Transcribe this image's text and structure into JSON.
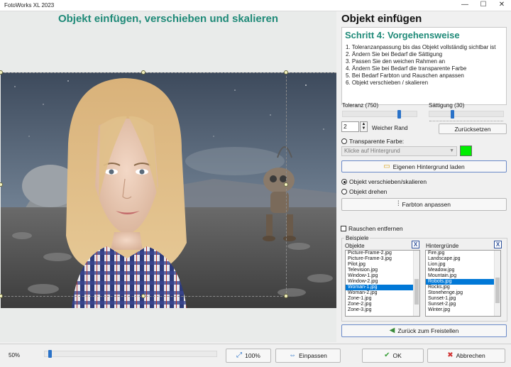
{
  "window": {
    "title": "FotoWorks XL 2023",
    "minimize_glyph": "—",
    "maximize_glyph": "☐",
    "close_glyph": "✕"
  },
  "canvas": {
    "title": "Objekt einfügen, verschieben und skalieren",
    "title_color": "#1f8a78"
  },
  "panel": {
    "heading": "Objekt einfügen",
    "step_title": "Schritt 4: Vorgehensweise",
    "steps": [
      "1. Toleranzanpassung bis das Objekt vollständig sichtbar ist",
      "2. Ändern Sie bei Bedarf die Sättigung",
      "3. Passen Sie den weichen Rahmen an",
      "4. Ändern Sie bei Bedarf die transparente Farbe",
      "5. Bei Bedarf Farbton und Rauschen anpassen",
      "6. Objekt verschieben / skalieren"
    ],
    "tolerance_label": "Toleranz (750)",
    "tolerance_level": 0.78,
    "saturation_label": "Sättigung (30)",
    "saturation_level": 0.3,
    "soft_edge_value": "2",
    "soft_edge_label": "Weicher Rand",
    "reset_label": "Zurücksetzen",
    "transparent_color_label": "Transparente Farbe:",
    "transparent_color_placeholder": "Klicke auf Hintergrund",
    "transparent_color_swatch": "#00ee00",
    "own_background_label": "Eigenen Hintergrund laden",
    "move_scale_label": "Objekt verschieben/skalieren",
    "rotate_label": "Objekt drehen",
    "hue_label": "Farbton anpassen",
    "noise_label": "Rauschen entfernen",
    "examples_label": "Beispiele",
    "objects_label": "Objekte",
    "backgrounds_label": "Hintergründe",
    "clear_label": "X",
    "objects": [
      "Picture-Frame-2.jpg",
      "Picture-Frame-3.jpg",
      "Pilot.jpg",
      "Television.jpg",
      "Window-1.jpg",
      "Window-2.jpg",
      "Woman-1.jpg",
      "Woman-2.jpg",
      "Zone-1.jpg",
      "Zone-2.jpg",
      "Zone-3.jpg"
    ],
    "objects_selected": 6,
    "backgrounds": [
      "Fire.jpg",
      "Landscape.jpg",
      "Lion.jpg",
      "Meadow.jpg",
      "Mountain.jpg",
      "Robots.jpg",
      "Rocks.jpg",
      "Stonehenge.jpg",
      "Sunset-1.jpg",
      "Sunset-2.jpg",
      "Winter.jpg"
    ],
    "backgrounds_selected": 5,
    "back_label": "Zurück zum Freistellen"
  },
  "bottom": {
    "zoom_label": "50%",
    "zoom_level": 0.02,
    "zoom100_label": "100%",
    "fit_label": "Einpassen",
    "ok_label": "OK",
    "cancel_label": "Abbrechen",
    "ok_icon_color": "#3aa03a",
    "cancel_icon_color": "#d03030"
  }
}
